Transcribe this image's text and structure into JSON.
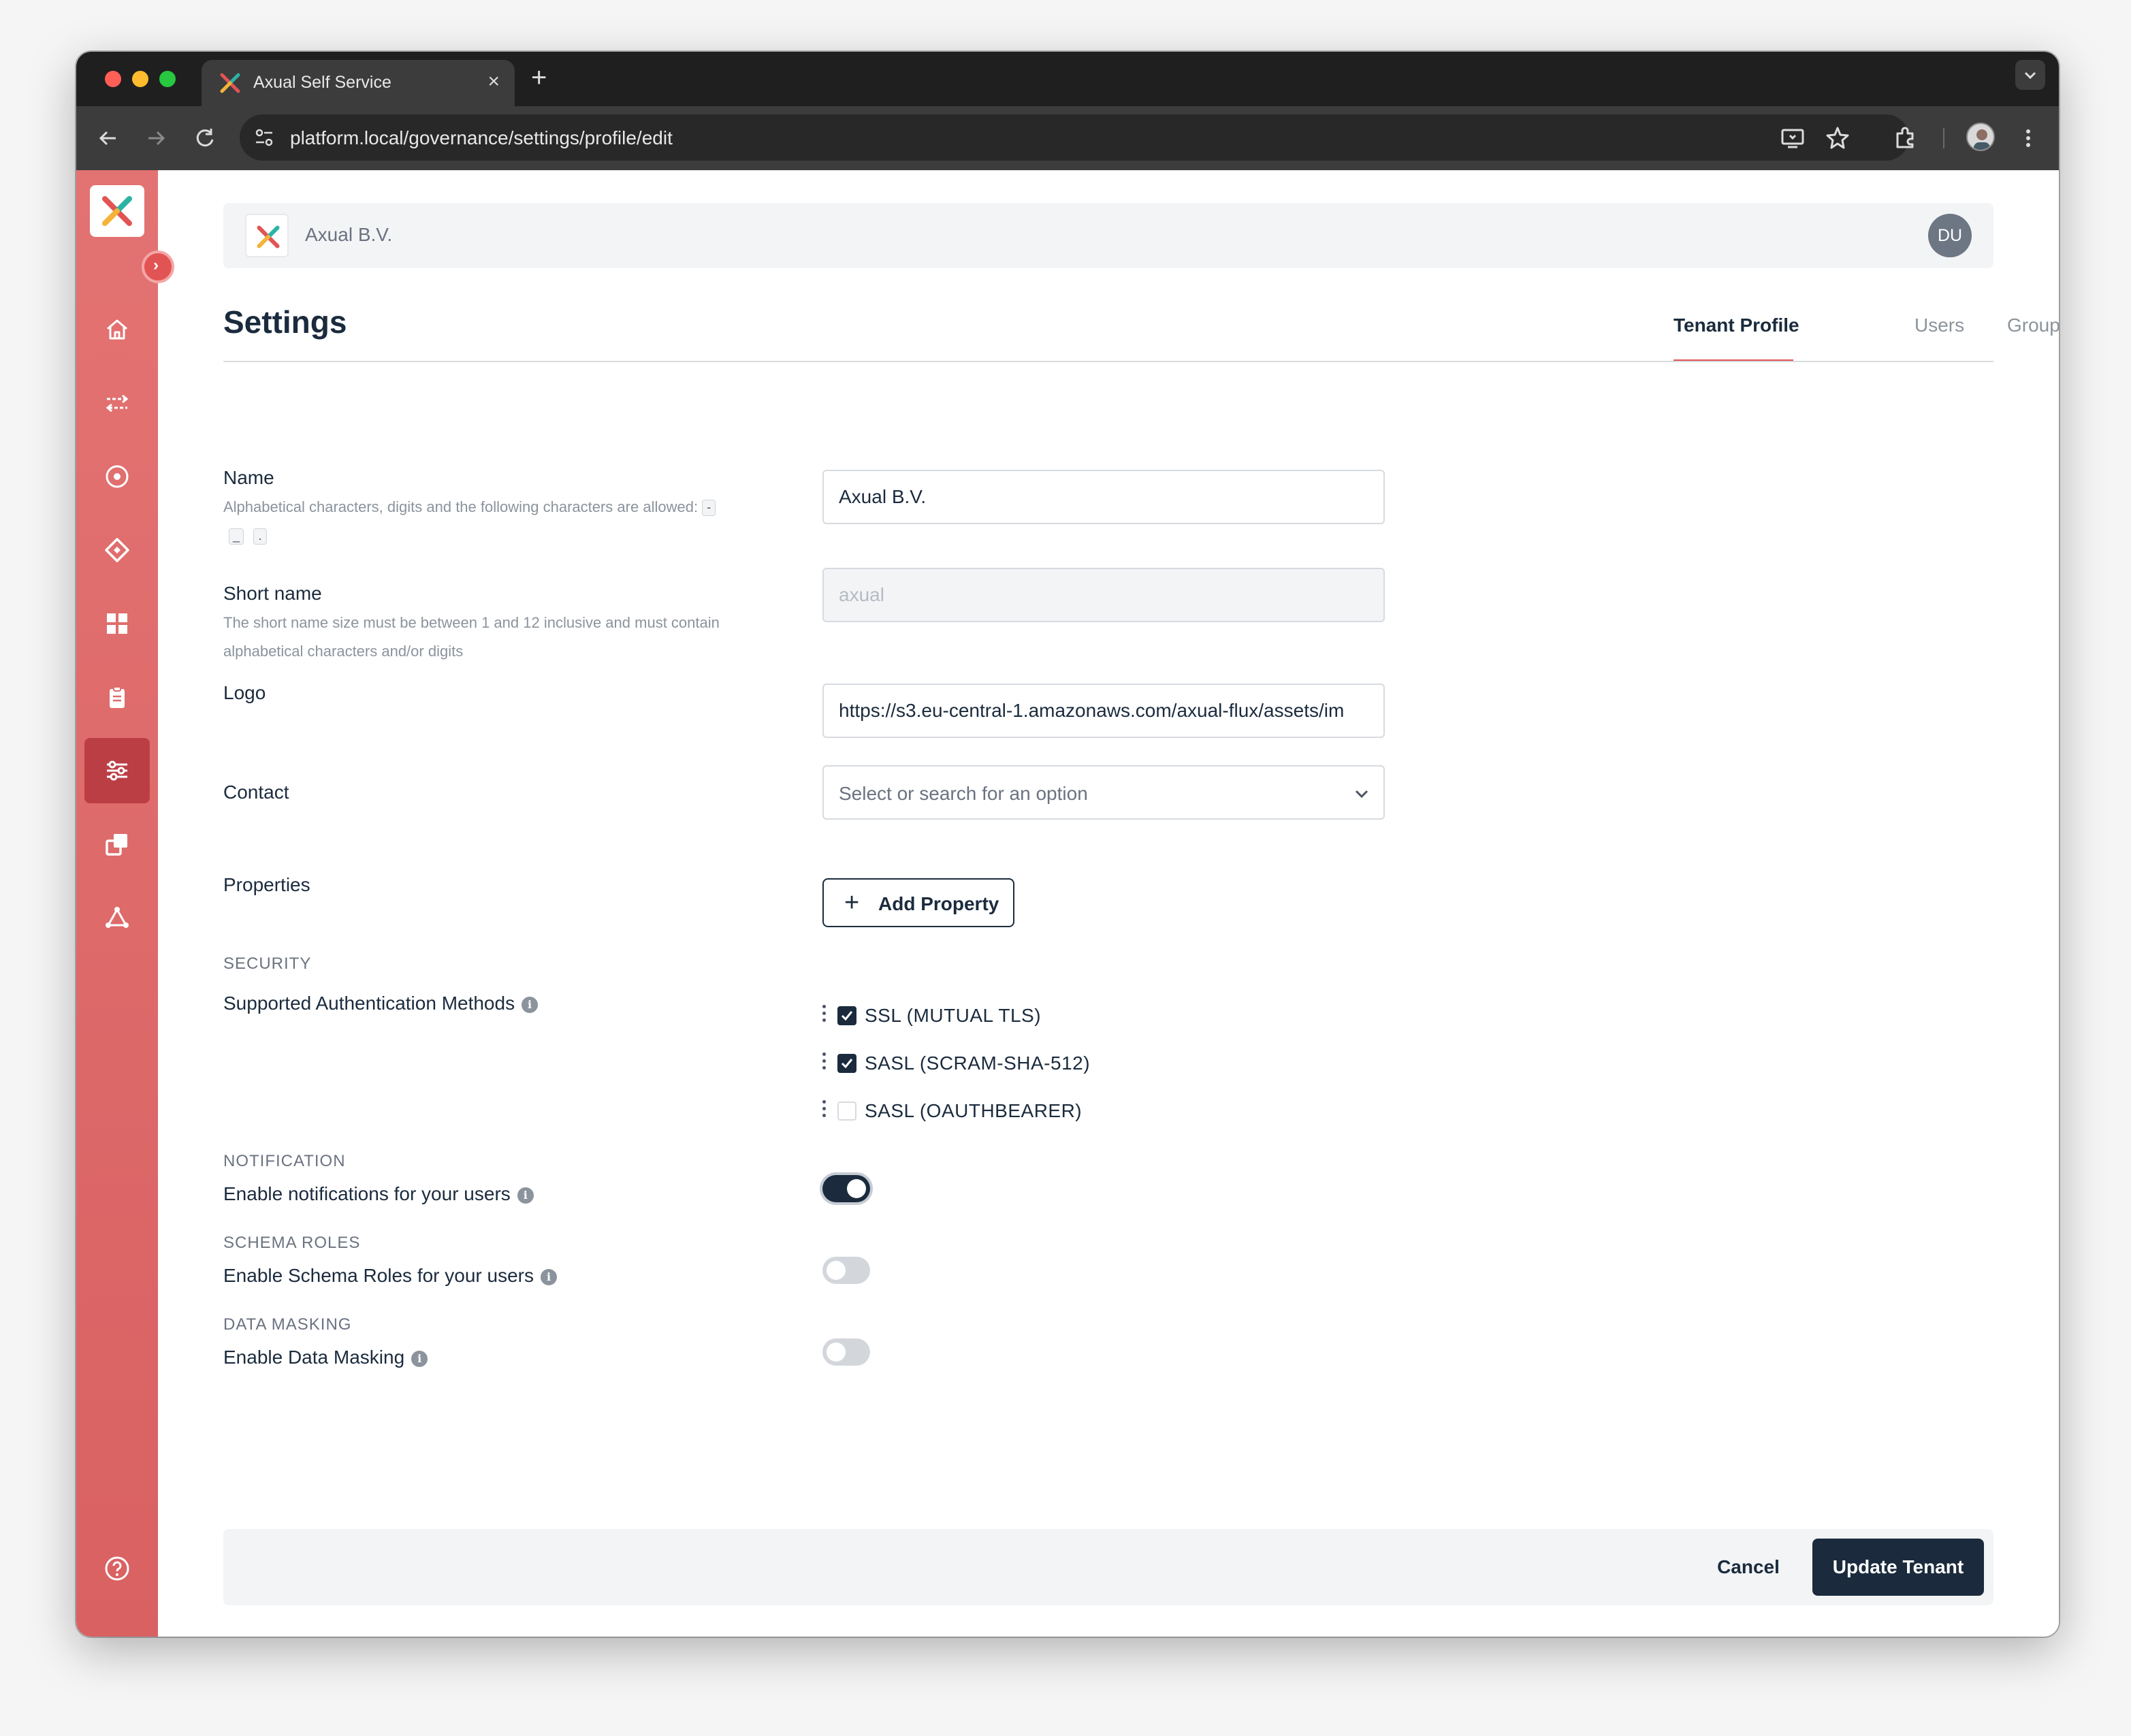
{
  "browser": {
    "tab_title": "Axual Self Service",
    "tab_close": "×",
    "new_tab": "+",
    "url": "platform.local/governance/settings/profile/edit"
  },
  "sidebar": {
    "collapse_glyph": "›",
    "items": [
      {
        "icon": "home-icon",
        "active": false
      },
      {
        "icon": "streams-icon",
        "active": false
      },
      {
        "icon": "target-icon",
        "active": false
      },
      {
        "icon": "diamond-icon",
        "active": false
      },
      {
        "icon": "dashboard-icon",
        "active": false
      },
      {
        "icon": "clipboard-icon",
        "active": false
      },
      {
        "icon": "settings-sliders-icon",
        "active": true
      },
      {
        "icon": "copy-icon",
        "active": false
      },
      {
        "icon": "network-icon",
        "active": false
      }
    ],
    "help_icon": "help-circle-icon"
  },
  "header": {
    "org_name": "Axual B.V.",
    "user_initials": "DU"
  },
  "page": {
    "title": "Settings",
    "tabs": [
      {
        "label": "Tenant Profile",
        "active": true
      },
      {
        "label": "Users",
        "active": false
      },
      {
        "label": "Groups",
        "active": false
      }
    ]
  },
  "form": {
    "name": {
      "label": "Name",
      "help": "Alphabetical characters, digits and the following characters are allowed:",
      "allowed_chars": [
        "-",
        "_",
        "."
      ],
      "value": "Axual B.V."
    },
    "short_name": {
      "label": "Short name",
      "help": "The short name size must be between 1 and 12 inclusive and must contain alphabetical characters and/or digits",
      "value": "axual"
    },
    "logo": {
      "label": "Logo",
      "value": "https://s3.eu-central-1.amazonaws.com/axual-flux/assets/im"
    },
    "contact": {
      "label": "Contact",
      "placeholder": "Select or search for an option"
    },
    "properties": {
      "label": "Properties",
      "add_button": "Add Property"
    },
    "security": {
      "section": "SECURITY",
      "label": "Supported Authentication Methods",
      "methods": [
        {
          "label": "SSL (MUTUAL TLS)",
          "checked": true
        },
        {
          "label": "SASL (SCRAM-SHA-512)",
          "checked": true
        },
        {
          "label": "SASL (OAUTHBEARER)",
          "checked": false
        }
      ]
    },
    "notification": {
      "section": "NOTIFICATION",
      "label": "Enable notifications for your users",
      "enabled": true
    },
    "schema_roles": {
      "section": "SCHEMA ROLES",
      "label": "Enable Schema Roles for your users",
      "enabled": false
    },
    "data_masking": {
      "section": "DATA MASKING",
      "label": "Enable Data Masking",
      "enabled": false
    },
    "info_glyph": "i"
  },
  "footer": {
    "cancel": "Cancel",
    "submit": "Update Tenant"
  },
  "colors": {
    "sidebar_top": "#e37372",
    "sidebar_active": "#bc3e45",
    "primary": "#1b2b3d",
    "accent": "#e25454"
  }
}
